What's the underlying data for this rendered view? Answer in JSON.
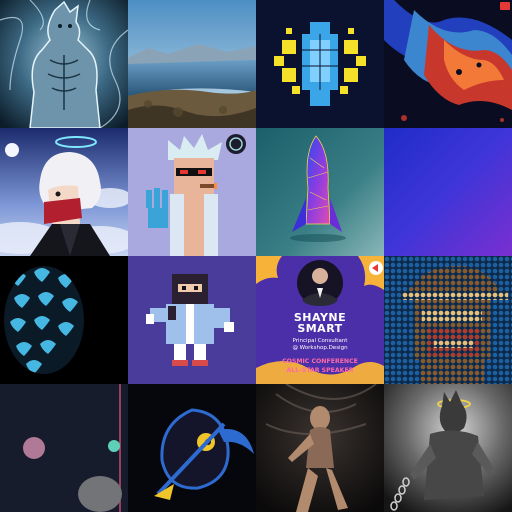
{
  "gallery": {
    "tiles": [
      {
        "icon": "chrome-reptile-warrior-art"
      },
      {
        "icon": "mountain-lake-landscape-photo"
      },
      {
        "icon": "blue-yellow-pixel-ship-art"
      },
      {
        "icon": "red-blue-heatmap-abstract-art"
      },
      {
        "icon": "anime-white-hair-halo-art"
      },
      {
        "icon": "pixel-scientist-cigar-art"
      },
      {
        "icon": "holographic-rocket-art"
      },
      {
        "icon": "blue-purple-gradient-art"
      },
      {
        "icon": "blue-bird-egg-pattern-art"
      },
      {
        "icon": "pixel-ninja-character-art"
      },
      {
        "icon": "speaker-card-art",
        "name_line1": "SHAYNE",
        "name_line2": "SMART",
        "role_line1": "Principal Consultant",
        "role_line2": "@ Workshop.Design",
        "banner_line1": "COSMIC CONFERENCE",
        "banner_line2": "ALL-STAR SPEAKER"
      },
      {
        "icon": "pixel-monkey-hat-art"
      },
      {
        "icon": "dark-circles-abstract-art"
      },
      {
        "icon": "reaper-scythe-art"
      },
      {
        "icon": "dark-dancer-photo"
      },
      {
        "icon": "chained-figure-halo-art"
      }
    ]
  }
}
